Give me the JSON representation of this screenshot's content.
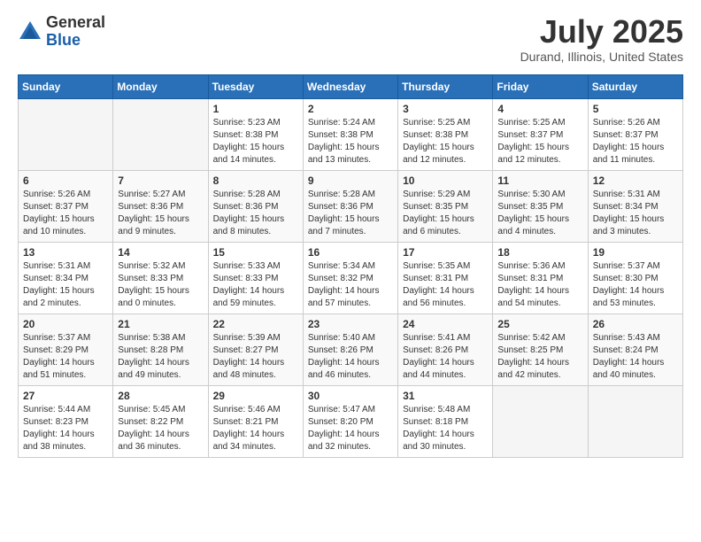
{
  "header": {
    "logo_general": "General",
    "logo_blue": "Blue",
    "month_title": "July 2025",
    "location": "Durand, Illinois, United States"
  },
  "weekdays": [
    "Sunday",
    "Monday",
    "Tuesday",
    "Wednesday",
    "Thursday",
    "Friday",
    "Saturday"
  ],
  "weeks": [
    [
      {
        "day": "",
        "info": ""
      },
      {
        "day": "",
        "info": ""
      },
      {
        "day": "1",
        "info": "Sunrise: 5:23 AM\nSunset: 8:38 PM\nDaylight: 15 hours and 14 minutes."
      },
      {
        "day": "2",
        "info": "Sunrise: 5:24 AM\nSunset: 8:38 PM\nDaylight: 15 hours and 13 minutes."
      },
      {
        "day": "3",
        "info": "Sunrise: 5:25 AM\nSunset: 8:38 PM\nDaylight: 15 hours and 12 minutes."
      },
      {
        "day": "4",
        "info": "Sunrise: 5:25 AM\nSunset: 8:37 PM\nDaylight: 15 hours and 12 minutes."
      },
      {
        "day": "5",
        "info": "Sunrise: 5:26 AM\nSunset: 8:37 PM\nDaylight: 15 hours and 11 minutes."
      }
    ],
    [
      {
        "day": "6",
        "info": "Sunrise: 5:26 AM\nSunset: 8:37 PM\nDaylight: 15 hours and 10 minutes."
      },
      {
        "day": "7",
        "info": "Sunrise: 5:27 AM\nSunset: 8:36 PM\nDaylight: 15 hours and 9 minutes."
      },
      {
        "day": "8",
        "info": "Sunrise: 5:28 AM\nSunset: 8:36 PM\nDaylight: 15 hours and 8 minutes."
      },
      {
        "day": "9",
        "info": "Sunrise: 5:28 AM\nSunset: 8:36 PM\nDaylight: 15 hours and 7 minutes."
      },
      {
        "day": "10",
        "info": "Sunrise: 5:29 AM\nSunset: 8:35 PM\nDaylight: 15 hours and 6 minutes."
      },
      {
        "day": "11",
        "info": "Sunrise: 5:30 AM\nSunset: 8:35 PM\nDaylight: 15 hours and 4 minutes."
      },
      {
        "day": "12",
        "info": "Sunrise: 5:31 AM\nSunset: 8:34 PM\nDaylight: 15 hours and 3 minutes."
      }
    ],
    [
      {
        "day": "13",
        "info": "Sunrise: 5:31 AM\nSunset: 8:34 PM\nDaylight: 15 hours and 2 minutes."
      },
      {
        "day": "14",
        "info": "Sunrise: 5:32 AM\nSunset: 8:33 PM\nDaylight: 15 hours and 0 minutes."
      },
      {
        "day": "15",
        "info": "Sunrise: 5:33 AM\nSunset: 8:33 PM\nDaylight: 14 hours and 59 minutes."
      },
      {
        "day": "16",
        "info": "Sunrise: 5:34 AM\nSunset: 8:32 PM\nDaylight: 14 hours and 57 minutes."
      },
      {
        "day": "17",
        "info": "Sunrise: 5:35 AM\nSunset: 8:31 PM\nDaylight: 14 hours and 56 minutes."
      },
      {
        "day": "18",
        "info": "Sunrise: 5:36 AM\nSunset: 8:31 PM\nDaylight: 14 hours and 54 minutes."
      },
      {
        "day": "19",
        "info": "Sunrise: 5:37 AM\nSunset: 8:30 PM\nDaylight: 14 hours and 53 minutes."
      }
    ],
    [
      {
        "day": "20",
        "info": "Sunrise: 5:37 AM\nSunset: 8:29 PM\nDaylight: 14 hours and 51 minutes."
      },
      {
        "day": "21",
        "info": "Sunrise: 5:38 AM\nSunset: 8:28 PM\nDaylight: 14 hours and 49 minutes."
      },
      {
        "day": "22",
        "info": "Sunrise: 5:39 AM\nSunset: 8:27 PM\nDaylight: 14 hours and 48 minutes."
      },
      {
        "day": "23",
        "info": "Sunrise: 5:40 AM\nSunset: 8:26 PM\nDaylight: 14 hours and 46 minutes."
      },
      {
        "day": "24",
        "info": "Sunrise: 5:41 AM\nSunset: 8:26 PM\nDaylight: 14 hours and 44 minutes."
      },
      {
        "day": "25",
        "info": "Sunrise: 5:42 AM\nSunset: 8:25 PM\nDaylight: 14 hours and 42 minutes."
      },
      {
        "day": "26",
        "info": "Sunrise: 5:43 AM\nSunset: 8:24 PM\nDaylight: 14 hours and 40 minutes."
      }
    ],
    [
      {
        "day": "27",
        "info": "Sunrise: 5:44 AM\nSunset: 8:23 PM\nDaylight: 14 hours and 38 minutes."
      },
      {
        "day": "28",
        "info": "Sunrise: 5:45 AM\nSunset: 8:22 PM\nDaylight: 14 hours and 36 minutes."
      },
      {
        "day": "29",
        "info": "Sunrise: 5:46 AM\nSunset: 8:21 PM\nDaylight: 14 hours and 34 minutes."
      },
      {
        "day": "30",
        "info": "Sunrise: 5:47 AM\nSunset: 8:20 PM\nDaylight: 14 hours and 32 minutes."
      },
      {
        "day": "31",
        "info": "Sunrise: 5:48 AM\nSunset: 8:18 PM\nDaylight: 14 hours and 30 minutes."
      },
      {
        "day": "",
        "info": ""
      },
      {
        "day": "",
        "info": ""
      }
    ]
  ]
}
